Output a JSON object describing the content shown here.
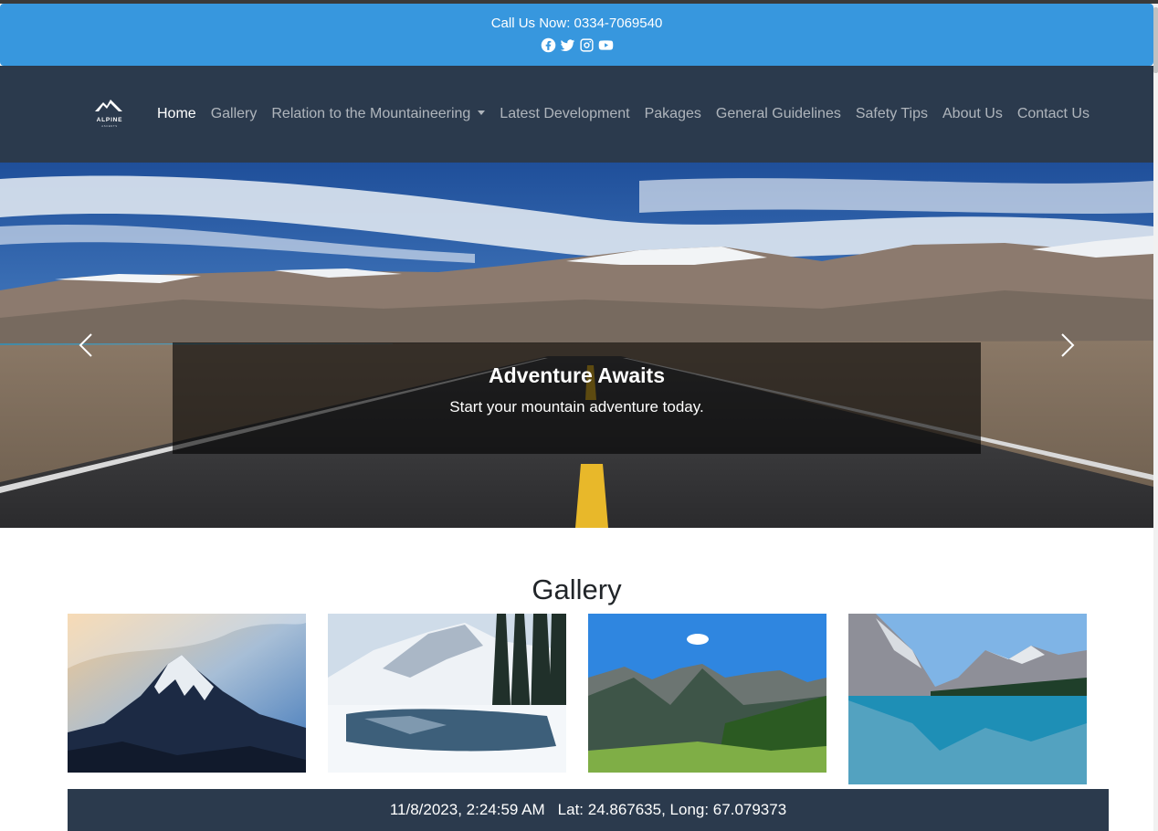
{
  "topbar": {
    "call_text": "Call Us Now: 0334-7069540",
    "social_icons": [
      "facebook-icon",
      "twitter-icon",
      "instagram-icon",
      "youtube-icon"
    ]
  },
  "navbar": {
    "brand_text": "ALPINE",
    "brand_subtext": "ASCENTS",
    "items": [
      {
        "label": "Home",
        "active": true
      },
      {
        "label": "Gallery"
      },
      {
        "label": "Relation to the Mountaineering",
        "dropdown": true
      },
      {
        "label": "Latest Development"
      },
      {
        "label": "Pakages"
      },
      {
        "label": "General Guidelines"
      },
      {
        "label": "Safety Tips"
      },
      {
        "label": "About Us"
      },
      {
        "label": "Contact Us"
      }
    ]
  },
  "hero": {
    "title": "Adventure Awaits",
    "subtitle": "Start your mountain adventure today."
  },
  "gallery": {
    "title": "Gallery"
  },
  "footer": {
    "datetime": "11/8/2023, 2:24:59 AM",
    "location": "Lat: 24.867635, Long: 67.079373"
  },
  "colors": {
    "topbar_bg": "#3797de",
    "navbar_bg": "#2b3a4d",
    "footer_bg": "#2b3a4d"
  }
}
